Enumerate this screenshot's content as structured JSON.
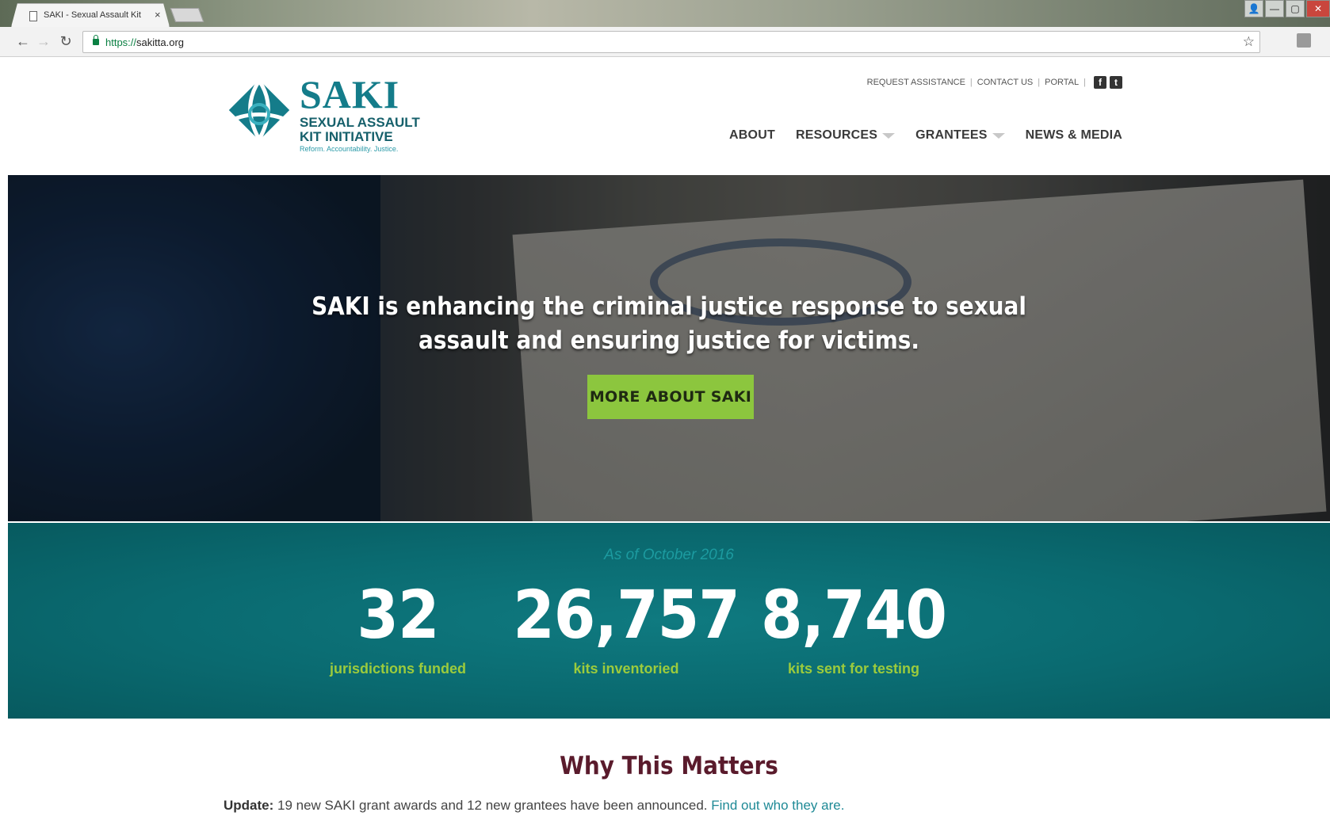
{
  "browser": {
    "tab_title": "SAKI - Sexual Assault Kit",
    "tab_close": "×",
    "url_scheme": "https://",
    "url_host": "sakitta.org",
    "back_icon": "←",
    "forward_icon": "→",
    "reload_icon": "↻",
    "star_icon": "☆",
    "window_buttons": {
      "user": "👤",
      "minimize": "—",
      "maximize": "▢",
      "close": "✕"
    }
  },
  "header": {
    "brand": "SAKI",
    "brand_line1": "SEXUAL ASSAULT",
    "brand_line2": "KIT INITIATIVE",
    "tagline": "Reform. Accountability. Justice.",
    "utility_links": [
      "REQUEST ASSISTANCE",
      "CONTACT US",
      "PORTAL"
    ],
    "social": {
      "facebook": "f",
      "twitter": "t"
    },
    "nav": [
      {
        "label": "ABOUT",
        "dropdown": false
      },
      {
        "label": "RESOURCES",
        "dropdown": true
      },
      {
        "label": "GRANTEES",
        "dropdown": true
      },
      {
        "label": "NEWS & MEDIA",
        "dropdown": false
      }
    ]
  },
  "hero": {
    "headline_line1": "SAKI is enhancing the criminal justice response to sexual",
    "headline_line2": "assault and ensuring justice for victims.",
    "cta_label": "MORE ABOUT SAKI"
  },
  "stats": {
    "as_of": "As of October 2016",
    "items": [
      {
        "value": "32",
        "label": "jurisdictions funded"
      },
      {
        "value": "26,757",
        "label": "kits inventoried"
      },
      {
        "value": "8,740",
        "label": "kits sent for testing"
      }
    ]
  },
  "why": {
    "title": "Why This Matters",
    "update_label": "Update:",
    "update_text": " 19 new SAKI grant awards and 12 new grantees have been announced. ",
    "update_link": "Find out who they are."
  },
  "colors": {
    "brand_teal": "#147c8a",
    "cta_green": "#8cc63e",
    "stats_bg": "#0a6a70",
    "stat_label_green": "#9ccb3c",
    "why_title": "#5a1b2c",
    "link": "#1f8a96"
  }
}
